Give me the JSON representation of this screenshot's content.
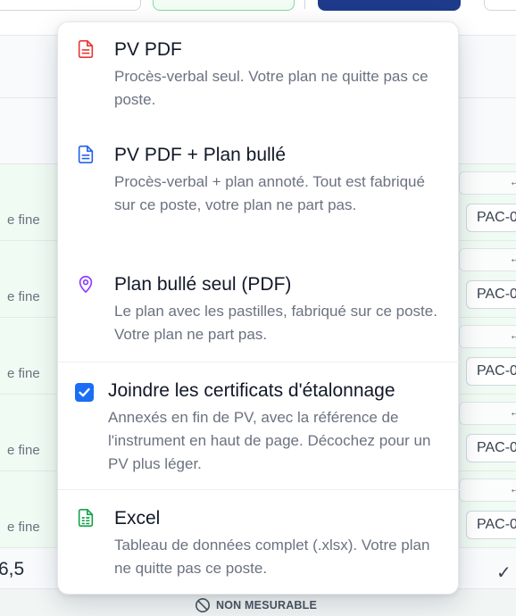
{
  "menu": {
    "items": [
      {
        "icon": "pdf-file-icon",
        "color": "#e53935",
        "title": "PV PDF",
        "description": "Procès-verbal seul. Votre plan ne quitte pas ce poste."
      },
      {
        "icon": "document-icon",
        "color": "#2563eb",
        "title": "PV PDF + Plan bullé",
        "description": "Procès-verbal + plan annoté. Tout est fabriqué sur ce poste, votre plan ne part pas."
      },
      {
        "icon": "map-pin-icon",
        "color": "#8b3dff",
        "title": "Plan bullé seul (PDF)",
        "description": "Le plan avec les pastilles, fabriqué sur ce poste. Votre plan ne part pas."
      },
      {
        "icon": "spreadsheet-icon",
        "color": "#16a34a",
        "title": "Excel",
        "description": "Tableau de données complet (.xlsx). Votre plan ne quitte pas ce poste."
      }
    ],
    "certificates": {
      "checked": true,
      "label": "Joindre les certificats d'étalonnage",
      "description": "Annexés en fin de PV, avec la référence de l'instrument en haut de page. Décochez pour un PV plus léger."
    }
  },
  "background": {
    "rows": [
      {
        "left_text": "e fine",
        "code": "PAC-0",
        "arrow": "←"
      },
      {
        "left_text": "e fine",
        "code": "PAC-0",
        "arrow": "←"
      },
      {
        "left_text": "e fine",
        "code": "PAC-0",
        "arrow": "←"
      },
      {
        "left_text": "e fine",
        "code": "PAC-0",
        "arrow": "←"
      },
      {
        "left_text": "e fine",
        "code": "PAC-0",
        "arrow": "←"
      }
    ],
    "bottom_value": "6,5",
    "bottom_check": "✓",
    "non_mesurable": "NON MESURABLE"
  }
}
